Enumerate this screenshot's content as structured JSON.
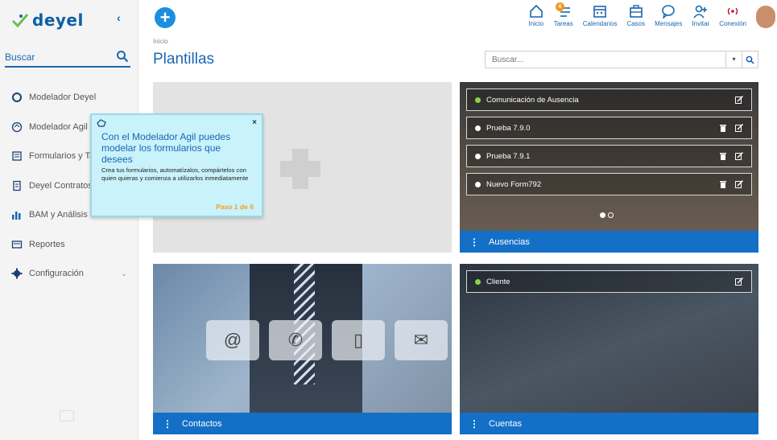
{
  "logo": {
    "text": "deyel"
  },
  "sidebar": {
    "search_placeholder": "Buscar",
    "items": [
      {
        "label": "Modelador Deyel",
        "icon": "circle-icon"
      },
      {
        "label": "Modelador Agil",
        "icon": "agile-icon"
      },
      {
        "label": "Formularios y Tareas",
        "icon": "forms-icon"
      },
      {
        "label": "Deyel Contratos",
        "icon": "contracts-icon"
      },
      {
        "label": "BAM y Análisis",
        "icon": "bam-chart-icon"
      },
      {
        "label": "Reportes",
        "icon": "reports-icon"
      },
      {
        "label": "Configuración",
        "icon": "gear-icon"
      }
    ]
  },
  "topnav": {
    "items": [
      {
        "label": "Inicio",
        "icon": "home-icon"
      },
      {
        "label": "Tareas",
        "icon": "tasks-icon",
        "badge": "4"
      },
      {
        "label": "Calendarios",
        "icon": "calendar-icon"
      },
      {
        "label": "Casos",
        "icon": "briefcase-icon"
      },
      {
        "label": "Mensajes",
        "icon": "message-icon"
      },
      {
        "label": "Invitar",
        "icon": "invite-icon"
      },
      {
        "label": "Conexión",
        "icon": "connection-icon"
      }
    ]
  },
  "page": {
    "breadcrumb": "Inicio",
    "title": "Plantillas",
    "search_placeholder": "Buscar..."
  },
  "cards": {
    "ausencias": {
      "title": "Ausencias",
      "forms": [
        {
          "name": "Comunicación de Ausencia",
          "status": "green",
          "delete": false
        },
        {
          "name": "Prueba 7.9.0",
          "status": "white",
          "delete": true
        },
        {
          "name": "Prueba 7.9.1",
          "status": "white",
          "delete": true
        },
        {
          "name": "Nuevo Form792",
          "status": "white",
          "delete": true
        }
      ]
    },
    "contactos": {
      "title": "Contactos",
      "icons": [
        "@",
        "phone",
        "tablet",
        "mail"
      ]
    },
    "cuentas": {
      "title": "Cuentas",
      "forms": [
        {
          "name": "Cliente",
          "status": "green"
        }
      ]
    }
  },
  "tooltip": {
    "title": "Con el Modelador Agil puedes modelar los formularios que desees",
    "body": "Crea tus formularios, automatízalos, compártelos con quien quieras y comienza a utilizarlos inmediatamente",
    "step": "Paso 1 de 6",
    "close": "×"
  },
  "colors": {
    "primary": "#1a66b3",
    "bar": "#1470c6",
    "accent_add": "#1a8fe0",
    "badge": "#f29b1d",
    "tooltip_bg": "#c9f2fb"
  }
}
